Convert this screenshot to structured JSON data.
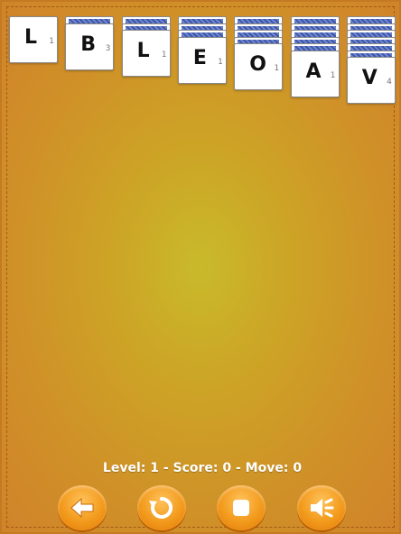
{
  "tableau": [
    {
      "hidden": 0,
      "letter": "L",
      "count": "1"
    },
    {
      "hidden": 1,
      "letter": "B",
      "count": "3"
    },
    {
      "hidden": 2,
      "letter": "L",
      "count": "1"
    },
    {
      "hidden": 3,
      "letter": "E",
      "count": "1"
    },
    {
      "hidden": 4,
      "letter": "O",
      "count": "1"
    },
    {
      "hidden": 5,
      "letter": "A",
      "count": "1"
    },
    {
      "hidden": 6,
      "letter": "V",
      "count": "4"
    }
  ],
  "status": "Level: 1 - Score: 0 - Move: 0",
  "controls": [
    {
      "name": "back-button",
      "icon": "arrow-left-icon"
    },
    {
      "name": "restart-button",
      "icon": "restart-icon"
    },
    {
      "name": "stop-button",
      "icon": "stop-icon"
    },
    {
      "name": "sound-button",
      "icon": "speaker-icon"
    }
  ],
  "colors": {
    "felt": "#cda226",
    "button": "#f29a1c",
    "card_back": "#3e56a8"
  }
}
